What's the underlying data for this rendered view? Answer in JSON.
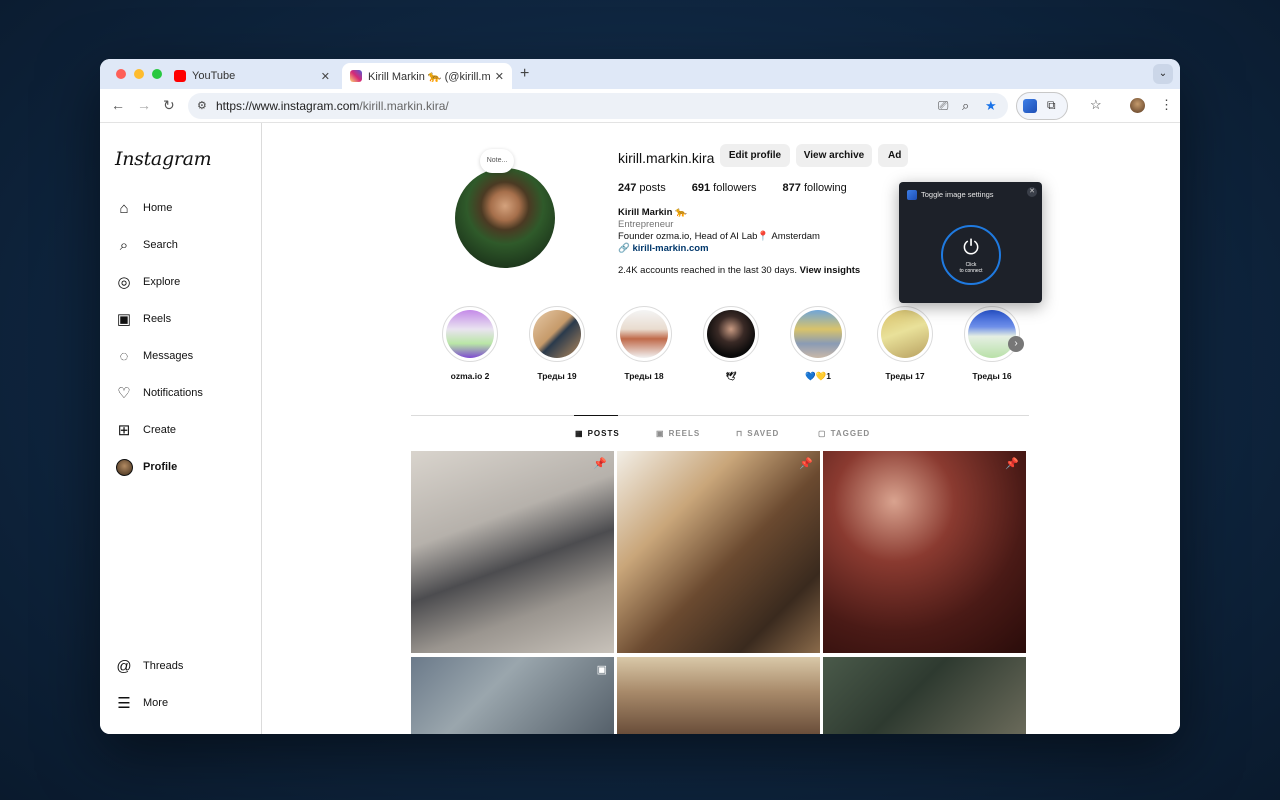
{
  "browser": {
    "tabs": [
      {
        "title": "YouTube"
      },
      {
        "title": "Kirill Markin 🐆 (@kirill.markin"
      }
    ],
    "url_main": "https://www.instagram.com",
    "url_path": "/kirill.markin.kira/",
    "tab_close": "✕",
    "new_tab": "+"
  },
  "instagram": {
    "logo": "Instagram",
    "nav": [
      {
        "label": "Home",
        "icon": "home-icon"
      },
      {
        "label": "Search",
        "icon": "search-icon"
      },
      {
        "label": "Explore",
        "icon": "compass-icon"
      },
      {
        "label": "Reels",
        "icon": "reels-icon"
      },
      {
        "label": "Messages",
        "icon": "messenger-icon"
      },
      {
        "label": "Notifications",
        "icon": "heart-icon"
      },
      {
        "label": "Create",
        "icon": "plus-square-icon"
      },
      {
        "label": "Profile",
        "icon": "avatar"
      },
      {
        "label": "Threads",
        "icon": "threads-icon"
      },
      {
        "label": "More",
        "icon": "menu-icon"
      }
    ],
    "note": "Note...",
    "profile": {
      "username": "kirill.markin.kira",
      "buttons": [
        "Edit profile",
        "View archive",
        "Ad"
      ],
      "posts": "247",
      "posts_label": "posts",
      "followers": "691",
      "followers_label": "followers",
      "following": "877",
      "following_label": "following",
      "name": "Kirill Markin 🐆",
      "category": "Entrepreneur",
      "bio": "Founder ozma.io, Head of AI Lab📍 Amsterdam",
      "link": "kirill-markin.com",
      "reach_text": "2.4K accounts reached in the last 30 days.",
      "reach_link": "View insights"
    },
    "highlights": [
      {
        "label": "ozma.io 2"
      },
      {
        "label": "Треды 19"
      },
      {
        "label": "Треды 18"
      },
      {
        "label": "🕊"
      },
      {
        "label": "💙💛1"
      },
      {
        "label": "Треды 17"
      },
      {
        "label": "Треды 16"
      }
    ],
    "tabs": [
      "POSTS",
      "REELS",
      "SAVED",
      "TAGGED"
    ]
  },
  "extension_popup": {
    "title": "Toggle image settings",
    "button_text_1": "Click",
    "button_text_2": "to connect"
  }
}
